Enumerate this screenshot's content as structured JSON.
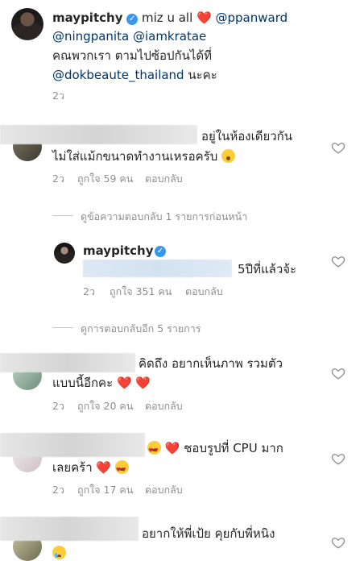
{
  "post": {
    "username": "maypitchy",
    "text_line1_pre": "miz u all",
    "mention1": "@ppanward",
    "mention2": "@ningpanita",
    "mention3": "@iamkratae",
    "line2": "คณพวกเรา ตามไปซ้อปกันได้ที่",
    "mention4": "@dokbeaute_thailand",
    "line3_suffix": "นะคะ",
    "time": "2ว"
  },
  "comments": [
    {
      "line1": "อยู่ในห้องเดียวกัน",
      "line2": "ไม่ใส่แม้กขนาดทำงานเหรอครับ",
      "time": "2ว",
      "likes": "ถูกใจ 59 คน",
      "reply": "ตอบกลับ"
    },
    {
      "view_replies": "ดูข้อความตอบกลับ 1 รายการก่อนหน้า"
    },
    {
      "username": "maypitchy",
      "text": "5ปีที่แล้วจ้ะ",
      "time": "2ว",
      "likes": "ถูกใจ 351 คน",
      "reply": "ตอบกลับ"
    },
    {
      "view_replies": "ดูการตอบกลับอีก 5 รายการ"
    },
    {
      "line1": "คิดถึง อยากเห็นภาพ รวมตัว",
      "line2": "แบบนี้อีกคะ",
      "time": "2ว",
      "likes": "ถูกใจ 20 คน",
      "reply": "ตอบกลับ"
    },
    {
      "line1": "ชอบรูปที่ CPU มาก",
      "line2": "เลยคร้า",
      "time": "2ว",
      "likes": "ถูกใจ 17 คน",
      "reply": "ตอบกลับ"
    },
    {
      "line1": "อยากให้พี่เป้ย คุยกับพี่หนิง"
    }
  ],
  "icons": {
    "verified": "verified-badge-icon",
    "like": "heart-outline-icon"
  },
  "colors": {
    "text": "#262626",
    "mention": "#003569",
    "meta": "#8e8e8e",
    "verified": "#3897f0",
    "heart": "#e0245e"
  }
}
